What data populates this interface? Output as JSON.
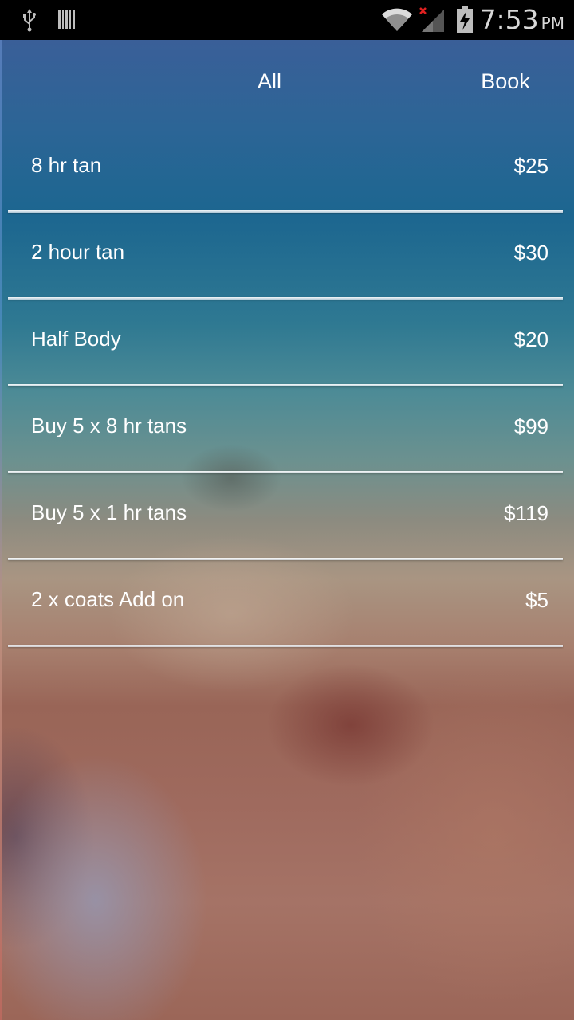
{
  "status_bar": {
    "time": "7:53",
    "ampm": "PM",
    "icons": [
      "usb-icon",
      "barcode-icon",
      "wifi-icon",
      "signal-icon",
      "battery-charging-icon"
    ]
  },
  "header": {
    "tab_label": "All",
    "book_label": "Book"
  },
  "services": [
    {
      "name": "8 hr tan",
      "price": "$25"
    },
    {
      "name": "2 hour tan",
      "price": "$30"
    },
    {
      "name": "Half Body",
      "price": "$20"
    },
    {
      "name": "Buy 5 x 8 hr tans",
      "price": "$99"
    },
    {
      "name": "Buy 5 x 1 hr tans",
      "price": "$119"
    },
    {
      "name": "2 x coats Add on",
      "price": "$5"
    }
  ],
  "colors": {
    "status_bar_bg": "#000000",
    "text": "#ffffff",
    "divider": "#ffffff",
    "missed_signal_x": "#e02020"
  }
}
